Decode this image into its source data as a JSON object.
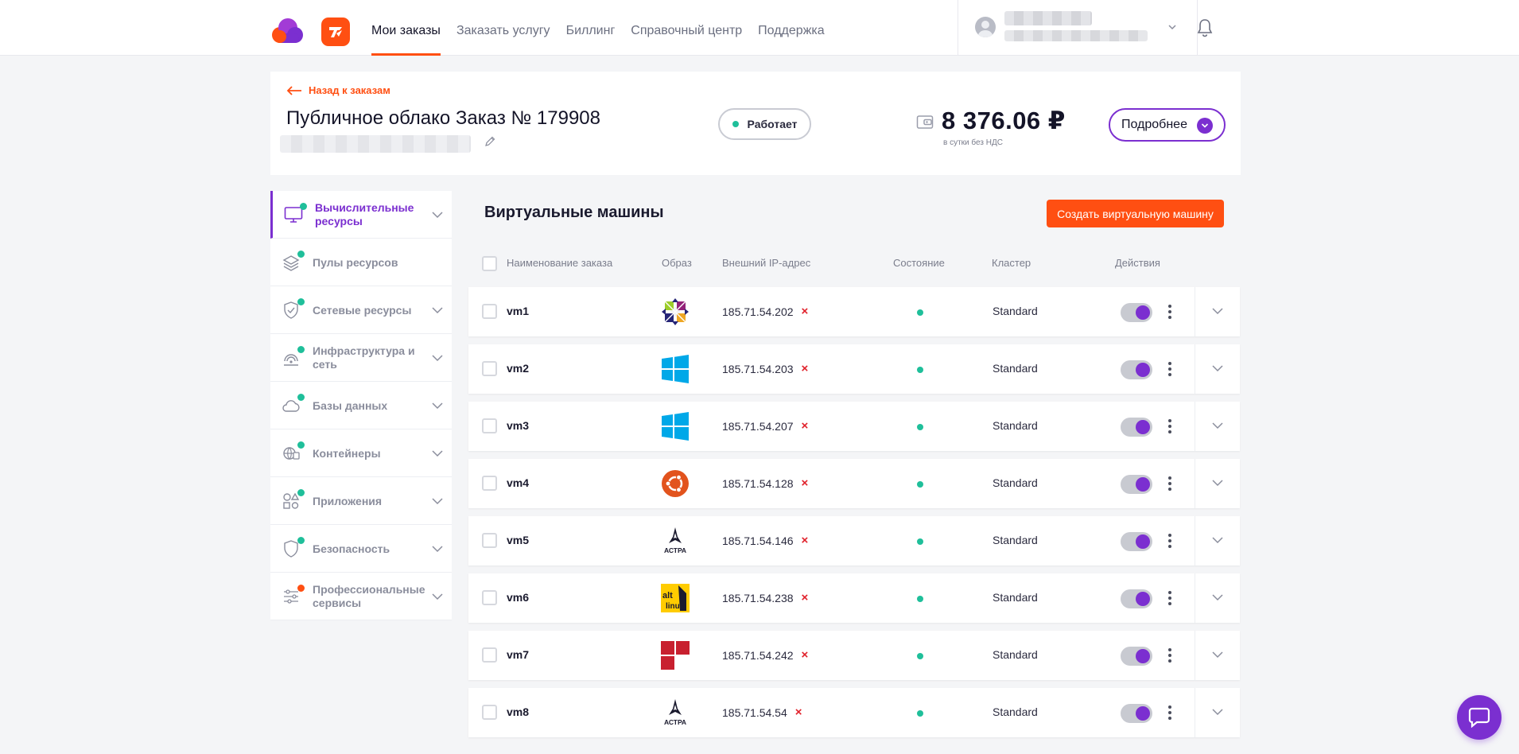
{
  "nav": {
    "items": [
      {
        "label": "Мои заказы",
        "active": true
      },
      {
        "label": "Заказать услугу"
      },
      {
        "label": "Биллинг"
      },
      {
        "label": "Справочный центр"
      },
      {
        "label": "Поддержка"
      }
    ]
  },
  "order": {
    "back_label": "Назад к заказам",
    "title": "Публичное облако Заказ № 179908",
    "status": "Работает",
    "price": "8 376.06 ₽",
    "price_note": "в сутки без НДС",
    "more_label": "Подробнее"
  },
  "sidebar": {
    "items": [
      {
        "label": "Вычислительные ресурсы",
        "icon": "monitor-icon",
        "active": true,
        "badge": "green",
        "expandable": true
      },
      {
        "label": "Пулы ресурсов",
        "icon": "layers-icon",
        "badge": "green",
        "expandable": false
      },
      {
        "label": "Сетевые ресурсы",
        "icon": "shield-icon",
        "badge": "green",
        "expandable": true
      },
      {
        "label": "Инфраструктура и сеть",
        "icon": "network-icon",
        "badge": "green",
        "expandable": true
      },
      {
        "label": "Базы данных",
        "icon": "cloud-icon",
        "badge": "green",
        "expandable": true
      },
      {
        "label": "Контейнеры",
        "icon": "container-icon",
        "badge": "green",
        "expandable": true
      },
      {
        "label": "Приложения",
        "icon": "apps-icon",
        "badge": "green",
        "expandable": true
      },
      {
        "label": "Безопасность",
        "icon": "security-shield-icon",
        "badge": "green",
        "expandable": true
      },
      {
        "label": "Профессиональные сервисы",
        "icon": "sliders-icon",
        "badge": "orange",
        "expandable": true
      }
    ]
  },
  "main": {
    "title": "Виртуальные машины",
    "create_label": "Создать виртуальную машину",
    "columns": [
      "Наименование заказа",
      "Образ",
      "Внешний IP-адрес",
      "Состояние",
      "Кластер",
      "Действия"
    ],
    "rows": [
      {
        "name": "vm1",
        "os": "centos",
        "ip": "185.71.54.202",
        "cluster": "Standard"
      },
      {
        "name": "vm2",
        "os": "windows",
        "ip": "185.71.54.203",
        "cluster": "Standard"
      },
      {
        "name": "vm3",
        "os": "windows",
        "ip": "185.71.54.207",
        "cluster": "Standard"
      },
      {
        "name": "vm4",
        "os": "ubuntu",
        "ip": "185.71.54.128",
        "cluster": "Standard"
      },
      {
        "name": "vm5",
        "os": "astra",
        "ip": "185.71.54.146",
        "cluster": "Standard"
      },
      {
        "name": "vm6",
        "os": "altlinux",
        "ip": "185.71.54.238",
        "cluster": "Standard"
      },
      {
        "name": "vm7",
        "os": "redos",
        "ip": "185.71.54.242",
        "cluster": "Standard"
      },
      {
        "name": "vm8",
        "os": "astra",
        "ip": "185.71.54.54",
        "cluster": "Standard"
      }
    ],
    "ip_remove_glyph": "×"
  },
  "os_labels": {
    "astra": "АСТРА",
    "alt_top": "alt",
    "alt_bottom": "linux"
  },
  "colors": {
    "accent": "#ff4f12",
    "brand": "#7b2fd0",
    "status_ok": "#1fbf9a"
  }
}
